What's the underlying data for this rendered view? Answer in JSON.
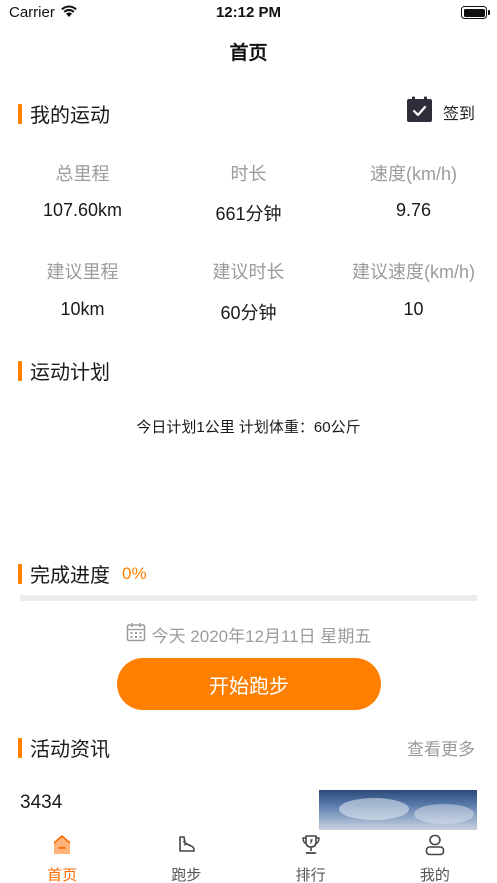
{
  "status_bar": {
    "carrier": "Carrier",
    "time": "12:12 PM"
  },
  "nav": {
    "title": "首页"
  },
  "my_sport": {
    "title": "我的运动",
    "checkin_label": "签到",
    "stats": [
      {
        "label": "总里程",
        "value": "107.60km"
      },
      {
        "label": "时长",
        "value": "661分钟"
      },
      {
        "label": "速度(km/h)",
        "value": "9.76"
      },
      {
        "label": "建议里程",
        "value": "10km"
      },
      {
        "label": "建议时长",
        "value": "60分钟"
      },
      {
        "label": "建议速度(km/h)",
        "value": "10"
      }
    ]
  },
  "plan": {
    "title": "运动计划",
    "text": "今日计划1公里 计划体重：60公斤"
  },
  "progress": {
    "title": "完成进度",
    "percent_label": "0%",
    "percent": 0
  },
  "date": {
    "text": "今天 2020年12月11日 星期五"
  },
  "start_button": {
    "label": "开始跑步"
  },
  "news": {
    "title": "活动资讯",
    "more_label": "查看更多",
    "items": [
      {
        "title": "3434"
      }
    ]
  },
  "tabs": [
    {
      "label": "首页",
      "icon": "home-icon",
      "active": true
    },
    {
      "label": "跑步",
      "icon": "shoe-icon",
      "active": false
    },
    {
      "label": "排行",
      "icon": "trophy-icon",
      "active": false
    },
    {
      "label": "我的",
      "icon": "user-icon",
      "active": false
    }
  ],
  "colors": {
    "accent": "#ff8000",
    "muted": "#9b9b9b",
    "tab_active": "#ff6a00"
  }
}
